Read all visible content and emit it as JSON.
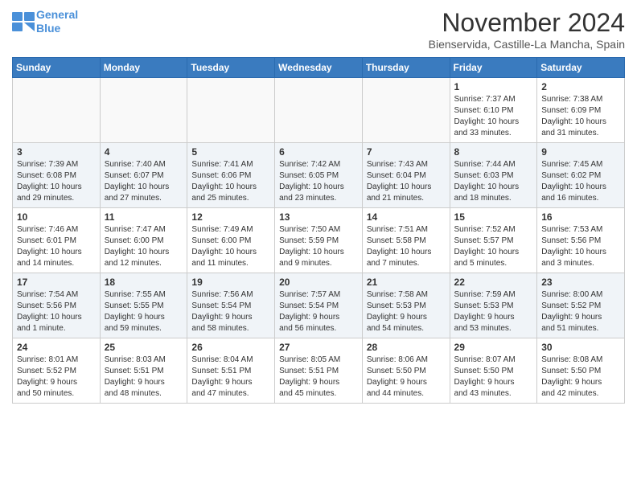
{
  "header": {
    "logo_line1": "General",
    "logo_line2": "Blue",
    "month": "November 2024",
    "location": "Bienservida, Castille-La Mancha, Spain"
  },
  "weekdays": [
    "Sunday",
    "Monday",
    "Tuesday",
    "Wednesday",
    "Thursday",
    "Friday",
    "Saturday"
  ],
  "weeks": [
    [
      {
        "day": "",
        "info": ""
      },
      {
        "day": "",
        "info": ""
      },
      {
        "day": "",
        "info": ""
      },
      {
        "day": "",
        "info": ""
      },
      {
        "day": "",
        "info": ""
      },
      {
        "day": "1",
        "info": "Sunrise: 7:37 AM\nSunset: 6:10 PM\nDaylight: 10 hours\nand 33 minutes."
      },
      {
        "day": "2",
        "info": "Sunrise: 7:38 AM\nSunset: 6:09 PM\nDaylight: 10 hours\nand 31 minutes."
      }
    ],
    [
      {
        "day": "3",
        "info": "Sunrise: 7:39 AM\nSunset: 6:08 PM\nDaylight: 10 hours\nand 29 minutes."
      },
      {
        "day": "4",
        "info": "Sunrise: 7:40 AM\nSunset: 6:07 PM\nDaylight: 10 hours\nand 27 minutes."
      },
      {
        "day": "5",
        "info": "Sunrise: 7:41 AM\nSunset: 6:06 PM\nDaylight: 10 hours\nand 25 minutes."
      },
      {
        "day": "6",
        "info": "Sunrise: 7:42 AM\nSunset: 6:05 PM\nDaylight: 10 hours\nand 23 minutes."
      },
      {
        "day": "7",
        "info": "Sunrise: 7:43 AM\nSunset: 6:04 PM\nDaylight: 10 hours\nand 21 minutes."
      },
      {
        "day": "8",
        "info": "Sunrise: 7:44 AM\nSunset: 6:03 PM\nDaylight: 10 hours\nand 18 minutes."
      },
      {
        "day": "9",
        "info": "Sunrise: 7:45 AM\nSunset: 6:02 PM\nDaylight: 10 hours\nand 16 minutes."
      }
    ],
    [
      {
        "day": "10",
        "info": "Sunrise: 7:46 AM\nSunset: 6:01 PM\nDaylight: 10 hours\nand 14 minutes."
      },
      {
        "day": "11",
        "info": "Sunrise: 7:47 AM\nSunset: 6:00 PM\nDaylight: 10 hours\nand 12 minutes."
      },
      {
        "day": "12",
        "info": "Sunrise: 7:49 AM\nSunset: 6:00 PM\nDaylight: 10 hours\nand 11 minutes."
      },
      {
        "day": "13",
        "info": "Sunrise: 7:50 AM\nSunset: 5:59 PM\nDaylight: 10 hours\nand 9 minutes."
      },
      {
        "day": "14",
        "info": "Sunrise: 7:51 AM\nSunset: 5:58 PM\nDaylight: 10 hours\nand 7 minutes."
      },
      {
        "day": "15",
        "info": "Sunrise: 7:52 AM\nSunset: 5:57 PM\nDaylight: 10 hours\nand 5 minutes."
      },
      {
        "day": "16",
        "info": "Sunrise: 7:53 AM\nSunset: 5:56 PM\nDaylight: 10 hours\nand 3 minutes."
      }
    ],
    [
      {
        "day": "17",
        "info": "Sunrise: 7:54 AM\nSunset: 5:56 PM\nDaylight: 10 hours\nand 1 minute."
      },
      {
        "day": "18",
        "info": "Sunrise: 7:55 AM\nSunset: 5:55 PM\nDaylight: 9 hours\nand 59 minutes."
      },
      {
        "day": "19",
        "info": "Sunrise: 7:56 AM\nSunset: 5:54 PM\nDaylight: 9 hours\nand 58 minutes."
      },
      {
        "day": "20",
        "info": "Sunrise: 7:57 AM\nSunset: 5:54 PM\nDaylight: 9 hours\nand 56 minutes."
      },
      {
        "day": "21",
        "info": "Sunrise: 7:58 AM\nSunset: 5:53 PM\nDaylight: 9 hours\nand 54 minutes."
      },
      {
        "day": "22",
        "info": "Sunrise: 7:59 AM\nSunset: 5:53 PM\nDaylight: 9 hours\nand 53 minutes."
      },
      {
        "day": "23",
        "info": "Sunrise: 8:00 AM\nSunset: 5:52 PM\nDaylight: 9 hours\nand 51 minutes."
      }
    ],
    [
      {
        "day": "24",
        "info": "Sunrise: 8:01 AM\nSunset: 5:52 PM\nDaylight: 9 hours\nand 50 minutes."
      },
      {
        "day": "25",
        "info": "Sunrise: 8:03 AM\nSunset: 5:51 PM\nDaylight: 9 hours\nand 48 minutes."
      },
      {
        "day": "26",
        "info": "Sunrise: 8:04 AM\nSunset: 5:51 PM\nDaylight: 9 hours\nand 47 minutes."
      },
      {
        "day": "27",
        "info": "Sunrise: 8:05 AM\nSunset: 5:51 PM\nDaylight: 9 hours\nand 45 minutes."
      },
      {
        "day": "28",
        "info": "Sunrise: 8:06 AM\nSunset: 5:50 PM\nDaylight: 9 hours\nand 44 minutes."
      },
      {
        "day": "29",
        "info": "Sunrise: 8:07 AM\nSunset: 5:50 PM\nDaylight: 9 hours\nand 43 minutes."
      },
      {
        "day": "30",
        "info": "Sunrise: 8:08 AM\nSunset: 5:50 PM\nDaylight: 9 hours\nand 42 minutes."
      }
    ]
  ]
}
